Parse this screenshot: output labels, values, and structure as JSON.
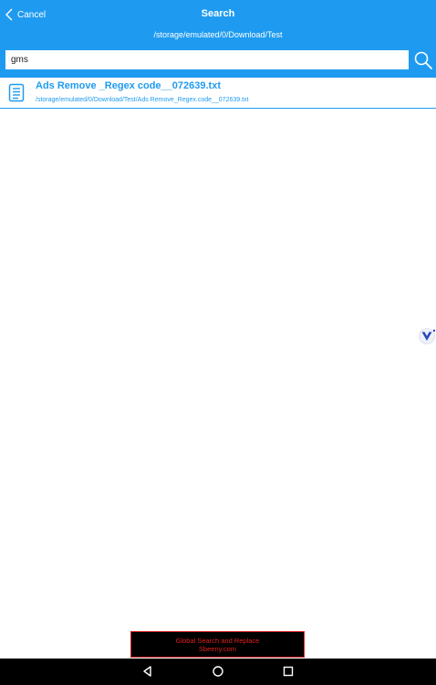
{
  "header": {
    "cancel_label": "Cancel",
    "title": "Search",
    "path": "/storage/emulated/0/Download/Test"
  },
  "search": {
    "value": "gms"
  },
  "results": [
    {
      "name": "Ads Remove _Regex code__072639.txt",
      "path": "/storage/emulated/0/Download/Test/Ads Remove_Regex.code__072639.txt",
      "icon": "document-icon"
    }
  ],
  "ad": {
    "line1": "Global Search and Replace",
    "line2": "Sbeeny.com"
  },
  "colors": {
    "accent": "#1e9bf0",
    "ad_text": "#e02020",
    "nav_bar": "#000000"
  },
  "icons": {
    "back": "chevron-left-icon",
    "search": "search-icon",
    "floating": "v-logo-icon",
    "nav_back": "triangle-back-icon",
    "nav_home": "circle-home-icon",
    "nav_recent": "square-recents-icon"
  }
}
